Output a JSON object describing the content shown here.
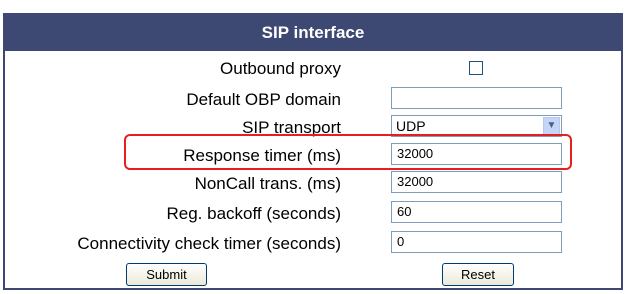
{
  "panel": {
    "title": "SIP interface"
  },
  "rows": [
    {
      "label": "Outbound proxy",
      "checked": false
    },
    {
      "label": "Default OBP domain",
      "value": ""
    },
    {
      "label": "SIP transport",
      "value": "UDP"
    },
    {
      "label": "Response timer (ms)",
      "value": "32000"
    },
    {
      "label": "NonCall trans. (ms)",
      "value": "32000"
    },
    {
      "label": "Reg. backoff (seconds)",
      "value": "60"
    },
    {
      "label": "Connectivity check timer (seconds)",
      "value": "0"
    }
  ],
  "buttons": {
    "submit": "Submit",
    "reset": "Reset"
  },
  "colors": {
    "header": "#3d4873",
    "highlight": "#e61e1e"
  },
  "icons": {
    "select_arrow": "chevron-down-icon"
  }
}
